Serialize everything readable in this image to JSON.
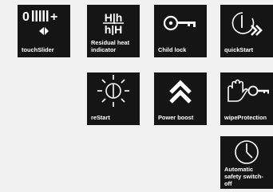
{
  "tiles": {
    "touch_slider": {
      "label": "touchSlider",
      "icon": "touch-slider-icon"
    },
    "residual_heat": {
      "label": "Residual heat indicator",
      "icon": "residual-heat-icon",
      "glyph_top": "H|h",
      "glyph_bottom": "h|H"
    },
    "child_lock": {
      "label": "Child lock",
      "icon": "key-icon"
    },
    "quick_start": {
      "label": "quickStart",
      "icon": "power-fast-forward-icon"
    },
    "restart": {
      "label": "reStart",
      "icon": "power-sun-icon"
    },
    "power_boost": {
      "label": "Power boost",
      "icon": "double-chevron-up-icon"
    },
    "wipe_protection": {
      "label": "wipeProtection",
      "icon": "hand-key-icon"
    },
    "auto_safety": {
      "label": "Automatic safety switch-off",
      "icon": "clock-icon"
    }
  },
  "colors": {
    "tile_bg": "#151515",
    "page_bg": "#f1f1f1",
    "fg": "#ffffff"
  }
}
